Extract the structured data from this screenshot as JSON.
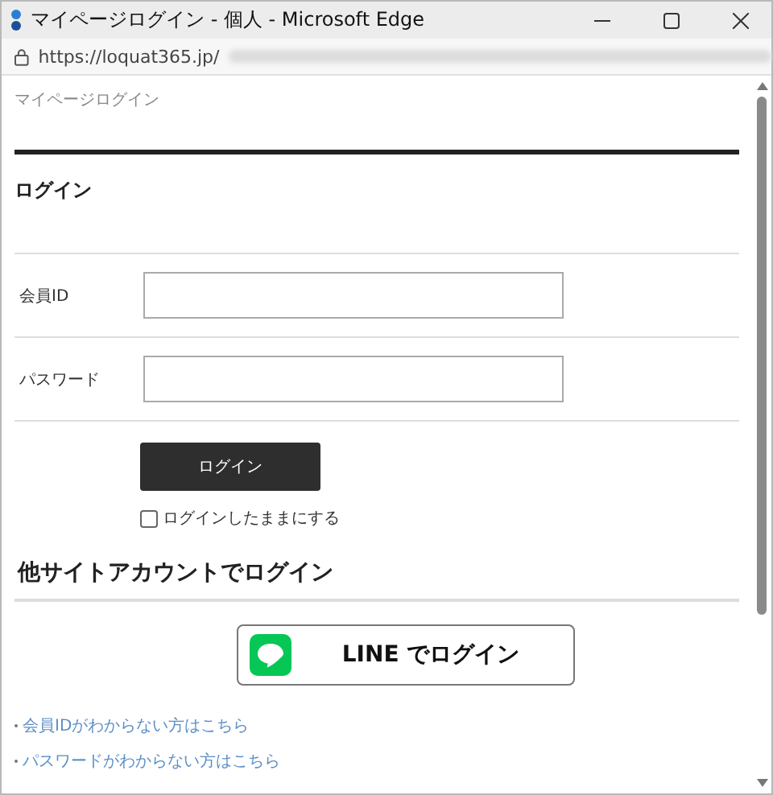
{
  "window": {
    "title": "マイページログイン - 個人 - Microsoft Edge"
  },
  "address_bar": {
    "url": "https://loquat365.jp/"
  },
  "breadcrumb": "マイページログイン",
  "heading": "ログイン",
  "fields": [
    {
      "label": "会員ID"
    },
    {
      "label": "パスワード"
    }
  ],
  "login_button": "ログイン",
  "remember": {
    "label": "ログインしたままにする",
    "checked": false
  },
  "social_heading": "他サイトアカウントでログイン",
  "line_button": "LINE でログイン",
  "links": [
    "会員IDがわからない方はこちら",
    "パスワードがわからない方はこちら"
  ]
}
